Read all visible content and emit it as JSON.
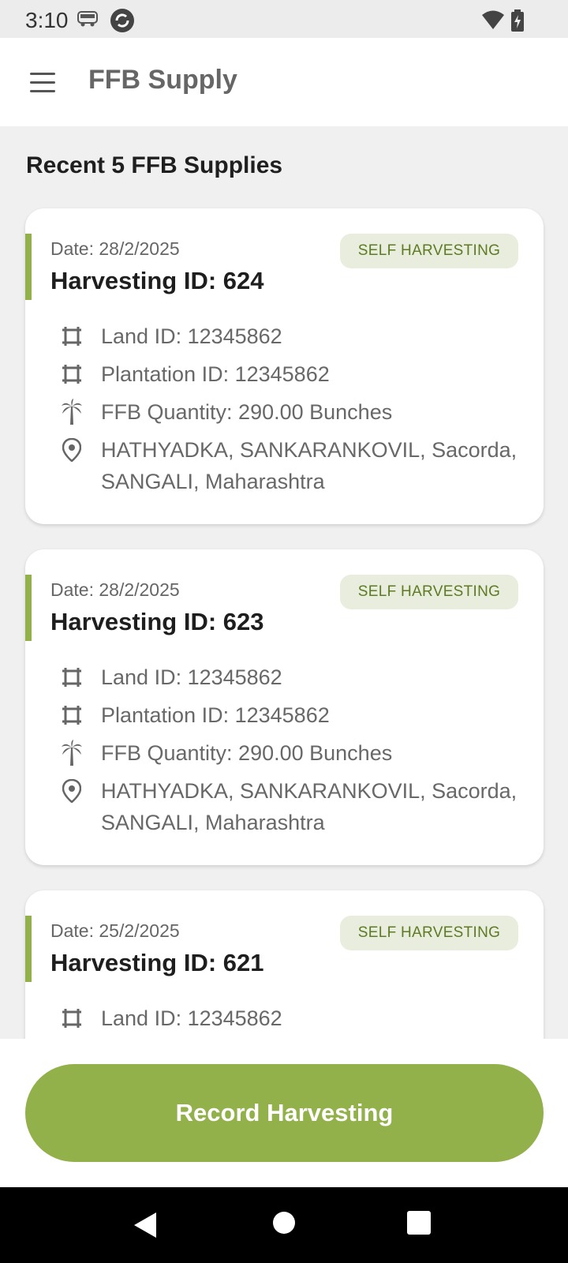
{
  "status_bar": {
    "time": "3:10"
  },
  "app_bar": {
    "title": "FFB Supply"
  },
  "section_title": "Recent 5 FFB Supplies",
  "cards": [
    {
      "date": "Date: 28/2/2025",
      "harvest_id": "Harvesting ID: 624",
      "badge": "SELF HARVESTING",
      "land_id": "Land ID: 12345862",
      "plantation_id": "Plantation ID: 12345862",
      "quantity": "FFB Quantity: 290.00 Bunches",
      "address": "HATHYADKA, SANKARANKOVIL, Sacorda, SANGALI, Maharashtra"
    },
    {
      "date": "Date: 28/2/2025",
      "harvest_id": "Harvesting ID: 623",
      "badge": "SELF HARVESTING",
      "land_id": "Land ID: 12345862",
      "plantation_id": "Plantation ID: 12345862",
      "quantity": "FFB Quantity: 290.00 Bunches",
      "address": "HATHYADKA, SANKARANKOVIL, Sacorda, SANGALI, Maharashtra"
    },
    {
      "date": "Date: 25/2/2025",
      "harvest_id": "Harvesting ID: 621",
      "badge": "SELF HARVESTING",
      "land_id": "Land ID: 12345862"
    }
  ],
  "record_button": {
    "label": "Record Harvesting"
  },
  "colors": {
    "accent": "#92b14a",
    "badge_bg": "#e9edde",
    "badge_text": "#5e7a22"
  }
}
